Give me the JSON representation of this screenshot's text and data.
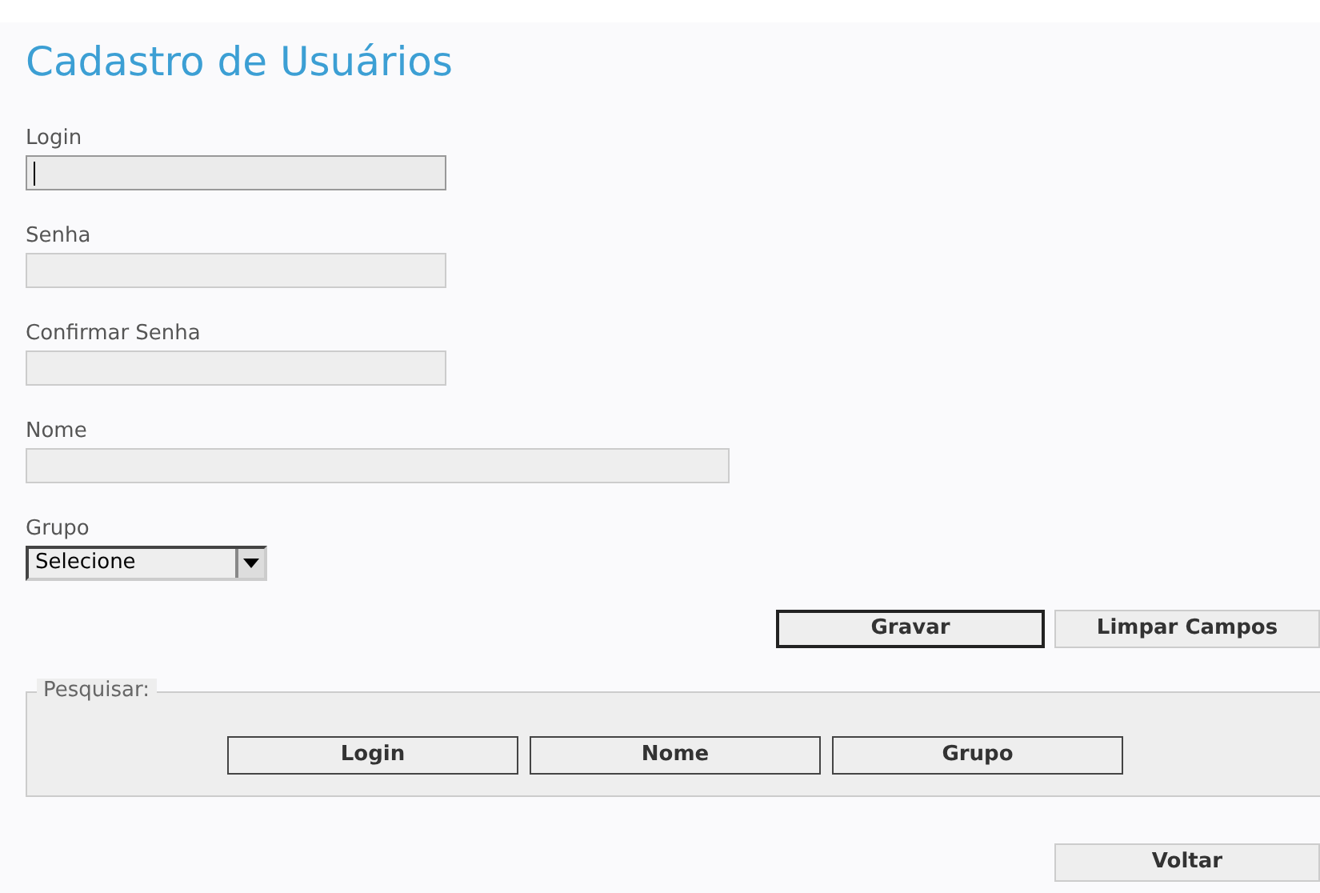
{
  "title": "Cadastro de Usuários",
  "fields": [
    {
      "kind": "text",
      "label": "Login",
      "focused": true
    },
    {
      "kind": "text",
      "label": "Senha",
      "focused": false
    },
    {
      "kind": "text",
      "label": "Confirmar Senha",
      "focused": false
    },
    {
      "kind": "wide_text",
      "label": "Nome",
      "focused": false
    },
    {
      "kind": "select",
      "label": "Grupo",
      "value": "Selecione",
      "focused": false
    }
  ],
  "actions": [
    {
      "label": "Gravar",
      "focused": true
    },
    {
      "label": "Limpar Campos",
      "focused": false
    }
  ],
  "search": {
    "legend": "Pesquisar:",
    "buttons": [
      "Login",
      "Nome",
      "Grupo"
    ]
  },
  "back_button": "Voltar"
}
